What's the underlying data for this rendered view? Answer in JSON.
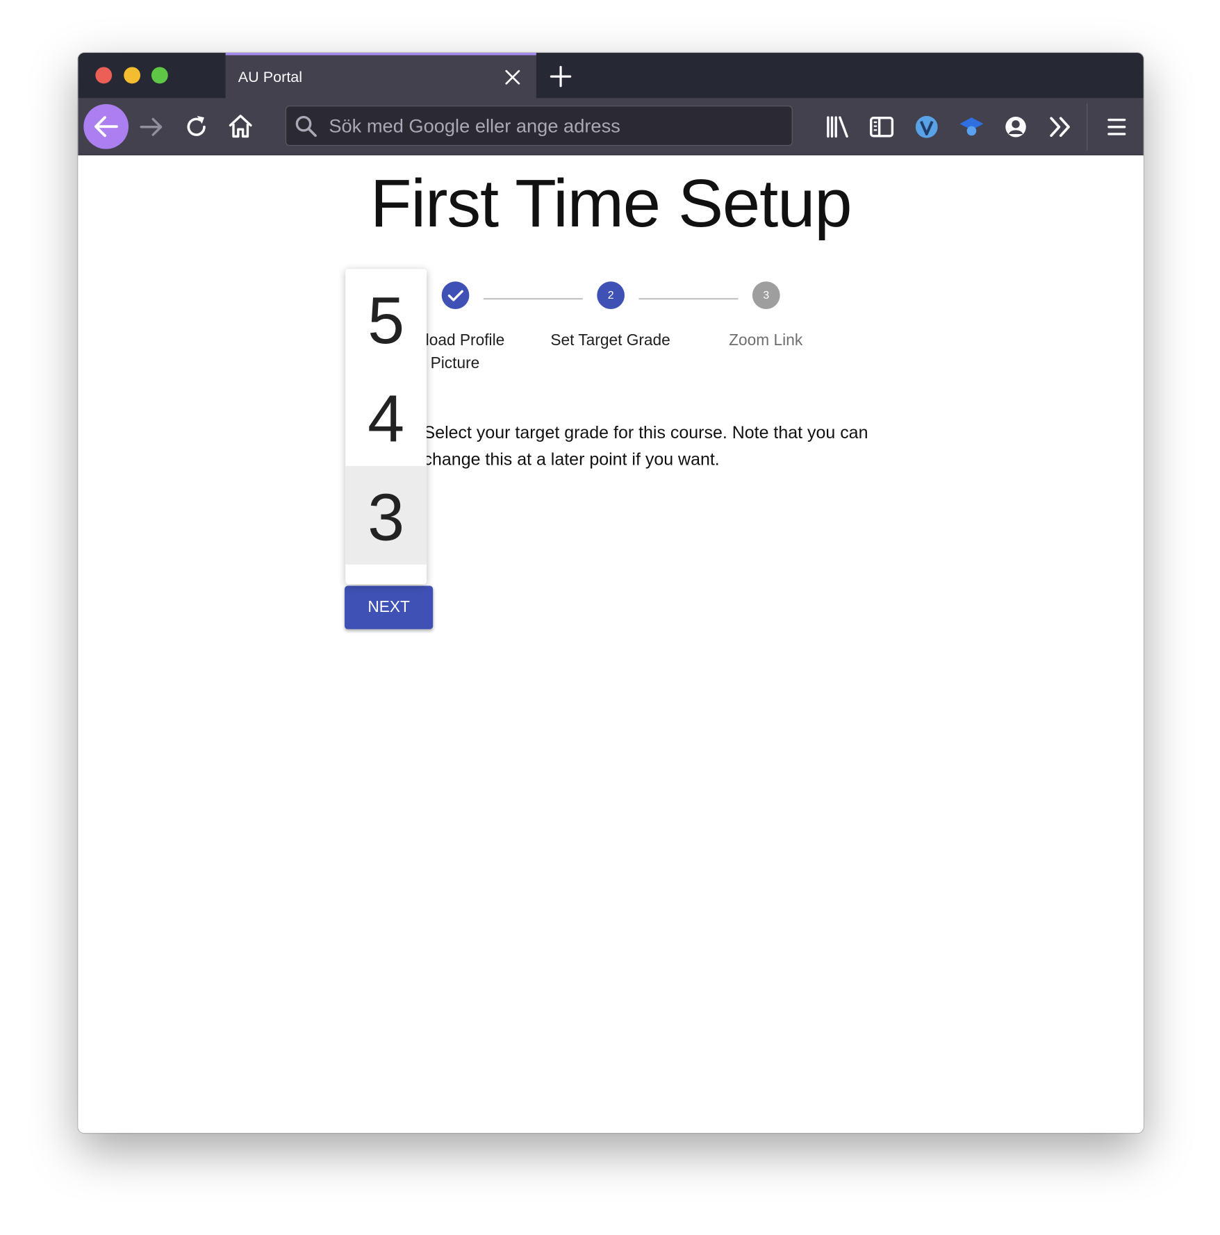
{
  "browser": {
    "tab_title": "AU Portal",
    "address_placeholder": "Sök med Google eller ange adress"
  },
  "page": {
    "title": "First Time Setup",
    "steps": [
      {
        "label": "Upload Profile Picture",
        "state": "completed"
      },
      {
        "label": "Set Target Grade",
        "state": "active",
        "number": "2"
      },
      {
        "label": "Zoom Link",
        "state": "pending",
        "number": "3"
      }
    ],
    "instructions_line1": "Select your target grade for this course. Note that you can",
    "instructions_line2": "change this at a later point if you want.",
    "next_label": "NEXT",
    "grade_options": [
      "5",
      "4",
      "3"
    ],
    "selected_grade": "3"
  },
  "colors": {
    "accent": "#3f51b5",
    "step_pending": "#9e9e9e",
    "tab_highlight": "#a68cf0",
    "back_button": "#ac7ff0"
  },
  "icons": [
    "close-icon",
    "plus-icon",
    "arrow-left-icon",
    "arrow-right-icon",
    "reload-icon",
    "home-icon",
    "search-icon",
    "library-icon",
    "sidebar-icon",
    "extension-icon",
    "graduation-cap-icon",
    "account-icon",
    "overflow-chevrons-icon",
    "hamburger-menu-icon",
    "checkmark-icon"
  ]
}
